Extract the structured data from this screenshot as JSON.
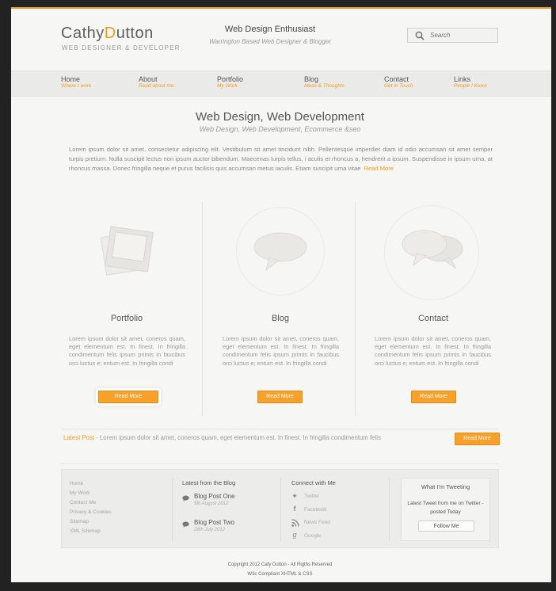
{
  "brand": {
    "name_a": "Cathy",
    "name_o": "D",
    "name_b": "utton",
    "subtitle": "WEB DESIGNER & DEVELOPER"
  },
  "header": {
    "tagline": "Web Design Enthusiast",
    "tagline_sub": "Warrington Based Web Designer & Blogger"
  },
  "search": {
    "placeholder": "Search",
    "icon": "search-icon"
  },
  "nav": [
    {
      "label": "Home",
      "sub": "Where I work"
    },
    {
      "label": "About",
      "sub": "Read about me"
    },
    {
      "label": "Portfolio",
      "sub": "My Work"
    },
    {
      "label": "Blog",
      "sub": "Ideas & Thoughts"
    },
    {
      "label": "Contact",
      "sub": "Get in Touch"
    },
    {
      "label": "Links",
      "sub": "People I Know"
    }
  ],
  "intro": {
    "title": "Web Design, Web Development",
    "subtitle": "Web Design, Web Development, Ecommerce &seo",
    "body": "Lorem ipsum dolor sit amet, consectetur adipiscing elit. Vestibulum sit amet tincidunt nibh. Pellentesque imperdiet diam id odio accumsan sit amet semper turpis pretium. Nulla suscipit lectus non ipsum auctor bibendum. Maecenas turpis tellus, i aculis et rhoncus a, hendrerit a ipsum. Suspendisse in ipsum urna, at rhoncus massa. Donec fringilla neque et purus facilisis quis accumsan metus iaculis. Etiam suscipit urna vitae",
    "read_more": "Read More"
  },
  "columns": [
    {
      "title": "Portfolio",
      "text": "Lorem ipsum dolor sit amet, coneros quam, eget elementum est. In finest. In fringilla condimentum felis ipsum primis in faucibus orci luctus e; entum est. In fringilla condi",
      "button": "Read More",
      "icon": "polaroid-icon"
    },
    {
      "title": "Blog",
      "text": "Lorem ipsum dolor sit amet, coneros quam, eget elementum est. In finest. In fringilla condimentum felis ipsum primis in faucibus orci luctus e; entum est. In fringilla condi",
      "button": "Read More",
      "icon": "speech-bubble-icon"
    },
    {
      "title": "Contact",
      "text": "Lorem ipsum dolor sit amet, coneros quam, eget elementum est. In finest. In fringilla condimentum felis ipsum primis in faucibus orci luctus e; entum est. In fringilla condi",
      "button": "Read More",
      "icon": "chat-bubbles-icon"
    }
  ],
  "latest": {
    "label": "Latest Post",
    "text": " - Lorem ipsum dolor sit amet, coneros quam, eget elementum est. In finest. In fringilla condimentum felis",
    "button": "Read More"
  },
  "footer": {
    "links": [
      "Home",
      "My Work",
      "Contact Me",
      "Privacy & Cookies",
      "Sitemap",
      "XML Sitemap"
    ],
    "blog_heading": "Latest from the Blog",
    "posts": [
      {
        "title": "Blog Post One",
        "date": "5th August 2012"
      },
      {
        "title": "Blog Post Two",
        "date": "28th July 2012"
      }
    ],
    "connect_heading": "Connect with Me",
    "social": [
      {
        "label": "Twitter",
        "icon": "twitter-icon"
      },
      {
        "label": "Facebook",
        "icon": "facebook-icon"
      },
      {
        "label": "News Feed",
        "icon": "rss-icon"
      },
      {
        "label": "Google",
        "icon": "google-icon"
      }
    ],
    "tweet_heading": "What I'm Tweeting",
    "tweet_text": "Latest Tweet from me on Twitter - posted Today",
    "follow": "Follow Me"
  },
  "copyright": {
    "line1": "Copyright 2012 Cafy Dutton - All Rigths Reserved",
    "line2": "W3c Compliant XHTML & CSS"
  },
  "colors": {
    "accent": "#f39a1d",
    "page_bg": "#f6f6f4",
    "frame_bg": "#222222"
  }
}
